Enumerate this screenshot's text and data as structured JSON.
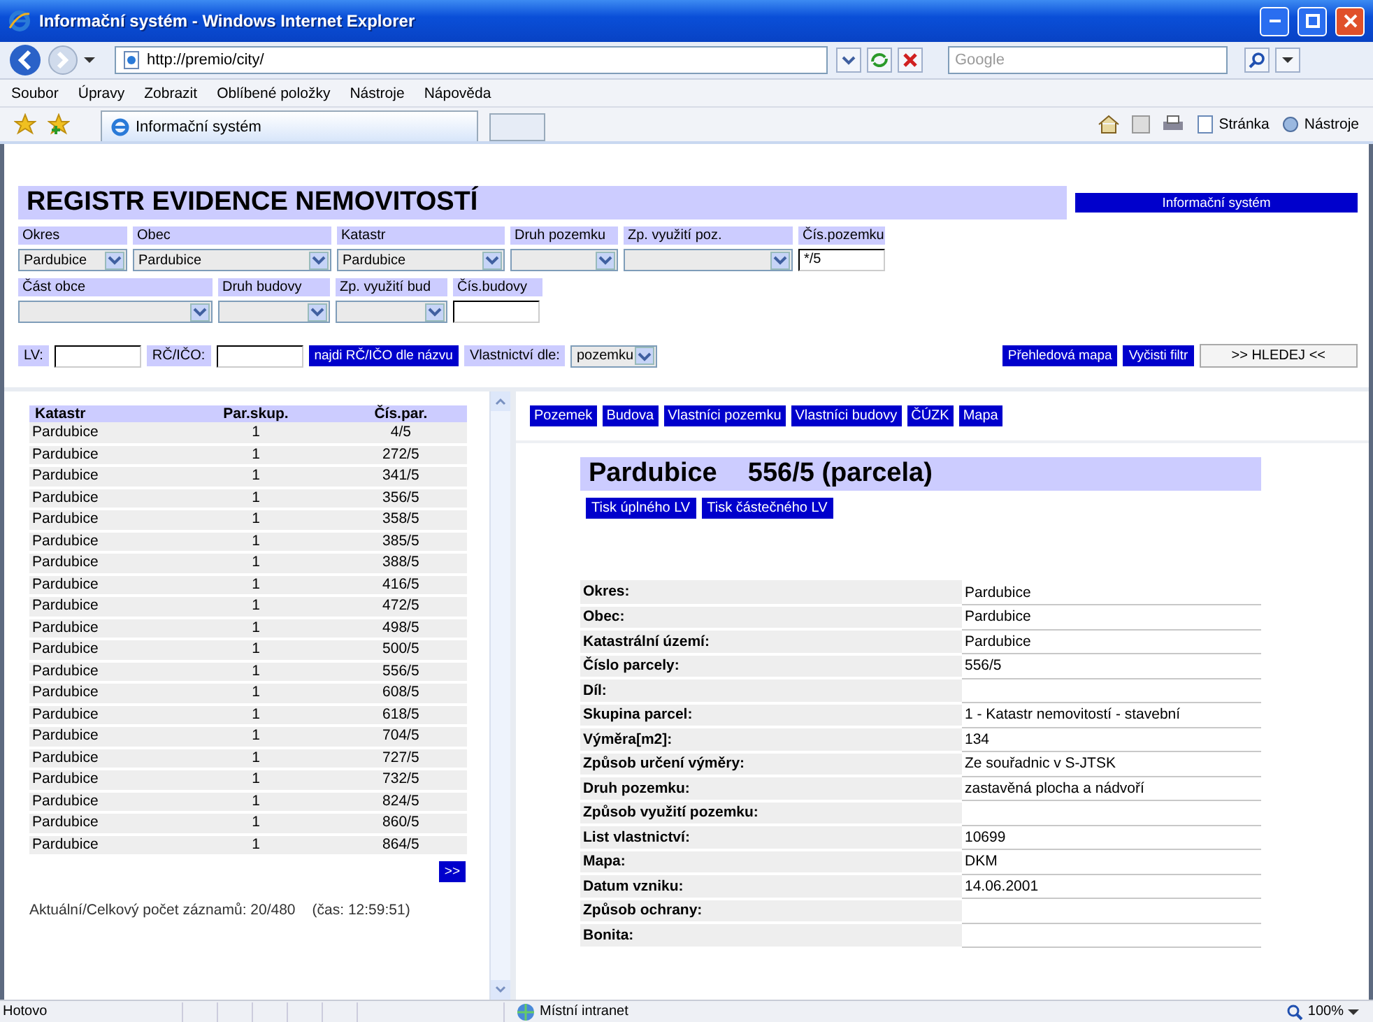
{
  "window": {
    "title": "Informační systém - Windows Internet Explorer"
  },
  "address_bar": {
    "url": "http://premio/city/"
  },
  "search": {
    "placeholder": "Google"
  },
  "menu": [
    "Soubor",
    "Úpravy",
    "Zobrazit",
    "Oblíbené položky",
    "Nástroje",
    "Nápověda"
  ],
  "browser_tab": {
    "title": "Informační systém"
  },
  "command_bar": [
    "Stránka",
    "Nástroje"
  ],
  "app": {
    "heading": "REGISTR EVIDENCE NEMOVITOSTÍ",
    "system_button": "Informační systém",
    "filter_rows": [
      [
        {
          "label": "Okres",
          "kind": "select",
          "value": "Pardubice"
        },
        {
          "label": "Obec",
          "kind": "select",
          "value": "Pardubice"
        },
        {
          "label": "Katastr",
          "kind": "select",
          "value": "Pardubice"
        },
        {
          "label": "Druh pozemku",
          "kind": "select"
        },
        {
          "label": "Zp. využití poz.",
          "kind": "select"
        },
        {
          "label": "Čís.pozemku",
          "kind": "input",
          "value": "*/5"
        }
      ],
      [
        {
          "label": "Část obce",
          "kind": "select"
        },
        {
          "label": "Druh budovy",
          "kind": "select"
        },
        {
          "label": "Zp. využití bud",
          "kind": "select"
        },
        {
          "label": "Čís.budovy",
          "kind": "input"
        }
      ]
    ],
    "lv_label": "LV:",
    "rc_label": "RČ/IČO:",
    "find_button": "najdi RČ/IČO dle názvu",
    "ownership_label": "Vlastnictví dle:",
    "ownership_value": "pozemku",
    "action_buttons": [
      {
        "label": "Přehledová mapa",
        "kind": "blue"
      },
      {
        "label": "Vyčisti filtr",
        "kind": "blue"
      },
      {
        "label": ">> HLEDEJ <<",
        "kind": "grey"
      }
    ]
  },
  "results": {
    "columns": [
      "Katastr",
      "Par.skup.",
      "Čís.par."
    ],
    "rows": [
      [
        "Pardubice",
        "1",
        "4/5"
      ],
      [
        "Pardubice",
        "1",
        "272/5"
      ],
      [
        "Pardubice",
        "1",
        "341/5"
      ],
      [
        "Pardubice",
        "1",
        "356/5"
      ],
      [
        "Pardubice",
        "1",
        "358/5"
      ],
      [
        "Pardubice",
        "1",
        "385/5"
      ],
      [
        "Pardubice",
        "1",
        "388/5"
      ],
      [
        "Pardubice",
        "1",
        "416/5"
      ],
      [
        "Pardubice",
        "1",
        "472/5"
      ],
      [
        "Pardubice",
        "1",
        "498/5"
      ],
      [
        "Pardubice",
        "1",
        "500/5"
      ],
      [
        "Pardubice",
        "1",
        "556/5"
      ],
      [
        "Pardubice",
        "1",
        "608/5"
      ],
      [
        "Pardubice",
        "1",
        "618/5"
      ],
      [
        "Pardubice",
        "1",
        "704/5"
      ],
      [
        "Pardubice",
        "1",
        "727/5"
      ],
      [
        "Pardubice",
        "1",
        "732/5"
      ],
      [
        "Pardubice",
        "1",
        "824/5"
      ],
      [
        "Pardubice",
        "1",
        "860/5"
      ],
      [
        "Pardubice",
        "1",
        "864/5"
      ]
    ],
    "next_button": ">>",
    "summary": "Aktuální/Celkový počet záznamů: 20/480",
    "time": "(čas: 12:59:51)"
  },
  "detail": {
    "tabs": [
      "Pozemek",
      "Budova",
      "Vlastníci pozemku",
      "Vlastníci budovy",
      "ČÚZK",
      "Mapa"
    ],
    "title_place": "Pardubice",
    "title_parcel": "556/5 (parcela)",
    "print_buttons": [
      "Tisk úplného LV",
      "Tisk částečného LV"
    ],
    "fields": [
      {
        "label": "Okres:",
        "value": "Pardubice"
      },
      {
        "label": "Obec:",
        "value": "Pardubice"
      },
      {
        "label": "Katastrální území:",
        "value": "Pardubice"
      },
      {
        "label": "Číslo parcely:",
        "value": "556/5"
      },
      {
        "label": "Díl:"
      },
      {
        "label": "Skupina parcel:",
        "value": "1 - Katastr nemovitostí - stavební"
      },
      {
        "label": "Výměra[m2]:",
        "value": "134"
      },
      {
        "label": "Způsob určení výměry:",
        "value": "Ze souřadnic v S-JTSK"
      },
      {
        "label": "Druh pozemku:",
        "value": "zastavěná plocha a nádvoří"
      },
      {
        "label": "Způsob využití pozemku:"
      },
      {
        "label": "List vlastnictví:",
        "value": "10699"
      },
      {
        "label": "Mapa:",
        "value": "DKM"
      },
      {
        "label": "Datum vzniku:",
        "value": "14.06.2001"
      },
      {
        "label": "Způsob ochrany:"
      },
      {
        "label": "Bonita:"
      }
    ]
  },
  "status_bar": {
    "text": "Hotovo",
    "zone": "Místní intranet",
    "zoom": "100%"
  }
}
